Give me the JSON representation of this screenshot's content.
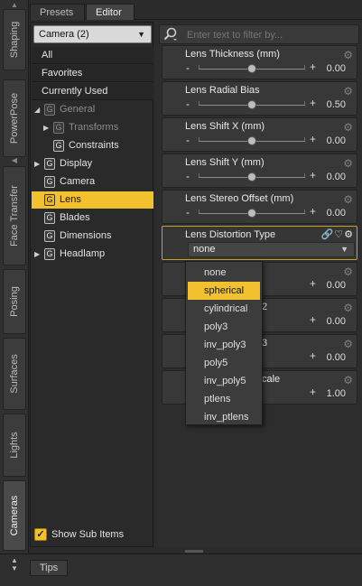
{
  "vtabs": [
    {
      "label": "Shaping",
      "active": false
    },
    {
      "label": "PowerPose",
      "active": false
    },
    {
      "label": "Face Transfer",
      "active": false
    },
    {
      "label": "Posing",
      "active": false
    },
    {
      "label": "Surfaces",
      "active": false
    },
    {
      "label": "Lights",
      "active": false
    },
    {
      "label": "Cameras",
      "active": true
    }
  ],
  "top_tabs": {
    "presets": "Presets",
    "editor": "Editor"
  },
  "left": {
    "dropdown": "Camera (2)",
    "groups": {
      "all": "All",
      "favorites": "Favorites",
      "currently_used": "Currently Used"
    },
    "tree": {
      "general": "General",
      "transforms": "Transforms",
      "constraints": "Constraints",
      "display": "Display",
      "camera": "Camera",
      "lens": "Lens",
      "blades": "Blades",
      "dimensions": "Dimensions",
      "headlamp": "Headlamp"
    },
    "group_glyph": "G",
    "show_sub_items": "Show Sub Items",
    "check_glyph": "✓"
  },
  "filter": {
    "placeholder": "Enter text to filter by..."
  },
  "props": {
    "lens_thickness": {
      "title": "Lens Thickness (mm)",
      "value": "0.00",
      "level": 0.5
    },
    "lens_radial_bias": {
      "title": "Lens Radial Bias",
      "value": "0.50",
      "level": 0.5
    },
    "lens_shift_x": {
      "title": "Lens Shift X (mm)",
      "value": "0.00",
      "level": 0.5
    },
    "lens_shift_y": {
      "title": "Lens Shift Y (mm)",
      "value": "0.00",
      "level": 0.5
    },
    "lens_stereo_offset": {
      "title": "Lens Stereo Offset (mm)",
      "value": "0.00",
      "level": 0.5
    },
    "lens_distortion_type": {
      "title": "Lens Distortion Type",
      "value": "none"
    },
    "hidden1": {
      "value": "0.00"
    },
    "hidden2": {
      "title": "2",
      "value": "0.00"
    },
    "hidden3": {
      "title": "3",
      "value": "0.00"
    },
    "hidden4": {
      "title": "cale",
      "value": "1.00"
    }
  },
  "menu": {
    "items": [
      "none",
      "spherical",
      "cylindrical",
      "poly3",
      "inv_poly3",
      "poly5",
      "inv_poly5",
      "ptlens",
      "inv_ptlens"
    ],
    "selected": "spherical"
  },
  "glyphs": {
    "minus": "-",
    "plus": "+",
    "gear": "⚙",
    "dropdown_arrow": "▼",
    "expand": "▶",
    "ltype_icons": "🔗♡⚙"
  },
  "bottom": {
    "tips": "Tips"
  },
  "colors": {
    "accent": "#f2c12e"
  }
}
